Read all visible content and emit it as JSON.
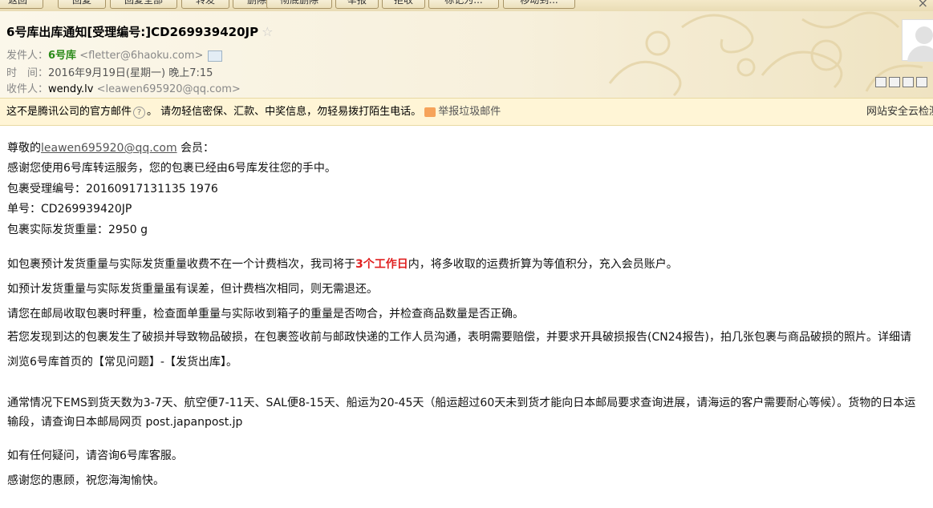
{
  "toolbar": {
    "buttons": [
      "返回",
      "回复",
      "回复全部",
      "转发",
      "删除",
      "彻底删除",
      "举报",
      "拒收",
      "标记为...",
      "移动到..."
    ],
    "close": "×"
  },
  "email": {
    "subject": "6号库出库通知[受理编号:]CD269939420JP",
    "star": "☆",
    "from_label": "发件人：",
    "from_name": "6号库",
    "from_addr": "<fletter@6haoku.com>",
    "time_label": "时　间：",
    "time_value": "2016年9月19日(星期一) 晚上7:15",
    "to_label": "收件人：",
    "to_name": "wendy.lv",
    "to_addr": "<leawen695920@qq.com>"
  },
  "warning": {
    "text1": "这不是腾讯公司的官方邮件",
    "help": "?",
    "text2": "。 请勿轻信密保、汇款、中奖信息，勿轻易拨打陌生电话。",
    "report": "举报垃圾邮件",
    "right": "网站安全云检测"
  },
  "body": {
    "greet_pre": "尊敬的",
    "greet_email": "leawen695920@qq.com",
    "greet_post": " 会员：",
    "l2": "感谢您使用6号库转运服务，您的包裹已经由6号库发往您的手中。",
    "l3": "包裹受理编号：20160917131135 1976",
    "l4": "单号：CD269939420JP",
    "l5": "包裹实际发货重量：2950 g",
    "p1_pre": "如包裹预计发货重量与实际发货重量收费不在一个计费档次，我司将于",
    "p1_red": "3个工作日",
    "p1_post": "内，将多收取的运费折算为等值积分，充入会员账户。",
    "p2": "如预计发货重量与实际发货重量虽有误差，但计费档次相同，则无需退还。",
    "p3": "请您在邮局收取包裹时秤重，检查面单重量与实际收到箱子的重量是否吻合，并检查商品数量是否正确。",
    "p4": "若您发现到达的包裹发生了破损并导致物品破损，在包裹签收前与邮政快递的工作人员沟通，表明需要赔偿，并要求开具破损报告(CN24报告)，拍几张包裹与商品破损的照片。详细请浏览6号库首页的【常见问题】-【发货出库】。",
    "p5": "通常情况下EMS到货天数为3-7天、航空便7-11天、SAL便8-15天、船运为20-45天（船运超过60天未到货才能向日本邮局要求查询进展，请海运的客户需要耐心等候）。货物的日本运输段，请查询日本邮局网页 post.japanpost.jp",
    "p6": "如有任何疑问，请咨询6号库客服。",
    "p7": "感谢您的惠顾，祝您海淘愉快。"
  },
  "colors": {
    "sender": "#2a8a18",
    "highlight": "#e02020",
    "warning_bg": "#fff5d6"
  }
}
